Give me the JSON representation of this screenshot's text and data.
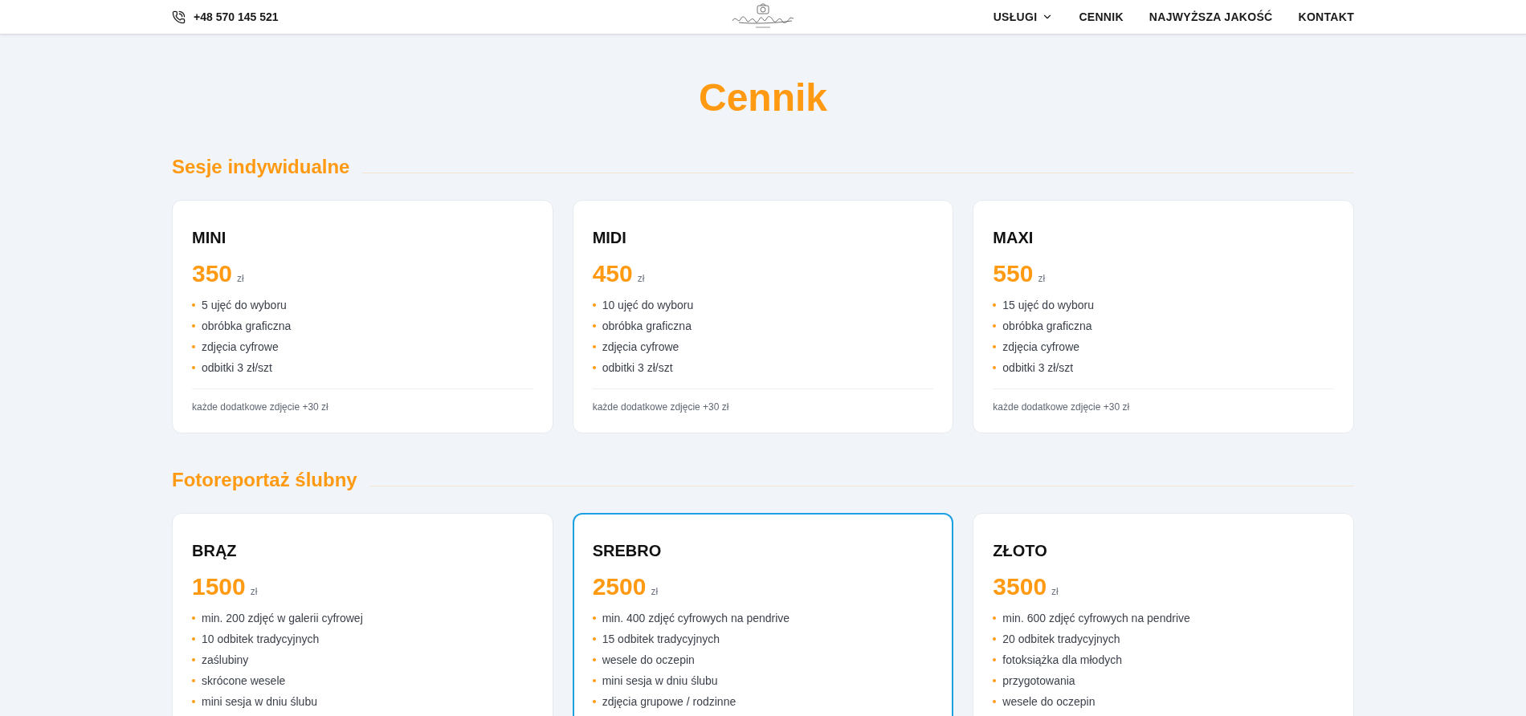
{
  "header": {
    "phone": "+48 570 145 521",
    "nav": [
      {
        "label": "USŁUGI",
        "kind": "dropdown"
      },
      {
        "label": "CENNIK",
        "kind": "link"
      },
      {
        "label": "NAJWYŻSZA JAKOŚĆ",
        "kind": "link"
      },
      {
        "label": "KONTAKT",
        "kind": "link"
      }
    ]
  },
  "page_title": "Cennik",
  "sections": [
    {
      "title": "Sesje indywidualne",
      "plans": [
        {
          "name": "MINI",
          "price": "350",
          "currency": "zł",
          "features": [
            "5 ujęć do wyboru",
            "obróbka graficzna",
            "zdjęcia cyfrowe",
            "odbitki 3 zł/szt"
          ],
          "note": "każde dodatkowe zdjęcie +30 zł",
          "highlighted": false
        },
        {
          "name": "MIDI",
          "price": "450",
          "currency": "zł",
          "features": [
            "10 ujęć do wyboru",
            "obróbka graficzna",
            "zdjęcia cyfrowe",
            "odbitki 3 zł/szt"
          ],
          "note": "każde dodatkowe zdjęcie +30 zł",
          "highlighted": false
        },
        {
          "name": "MAXI",
          "price": "550",
          "currency": "zł",
          "features": [
            "15 ujęć do wyboru",
            "obróbka graficzna",
            "zdjęcia cyfrowe",
            "odbitki 3 zł/szt"
          ],
          "note": "każde dodatkowe zdjęcie +30 zł",
          "highlighted": false
        }
      ]
    },
    {
      "title": "Fotoreportaż ślubny",
      "plans": [
        {
          "name": "BRĄZ",
          "price": "1500",
          "currency": "zł",
          "features": [
            "min. 200 zdjęć w galerii cyfrowej",
            "10 odbitek tradycyjnych",
            "zaślubiny",
            "skrócone wesele",
            "mini sesja w dniu ślubu"
          ],
          "highlighted": false
        },
        {
          "name": "SREBRO",
          "price": "2500",
          "currency": "zł",
          "features": [
            "min. 400 zdjęć cyfrowych na pendrive",
            "15 odbitek tradycyjnych",
            "wesele do oczepin",
            "mini sesja w dniu ślubu",
            "zdjęcia grupowe / rodzinne"
          ],
          "highlighted": true
        },
        {
          "name": "ZŁOTO",
          "price": "3500",
          "currency": "zł",
          "features": [
            "min. 600 zdjęć cyfrowych na pendrive",
            "20 odbitek tradycyjnych",
            "fotoksiążka dla młodych",
            "przygotowania",
            "wesele do oczepin"
          ],
          "highlighted": false
        }
      ]
    }
  ]
}
